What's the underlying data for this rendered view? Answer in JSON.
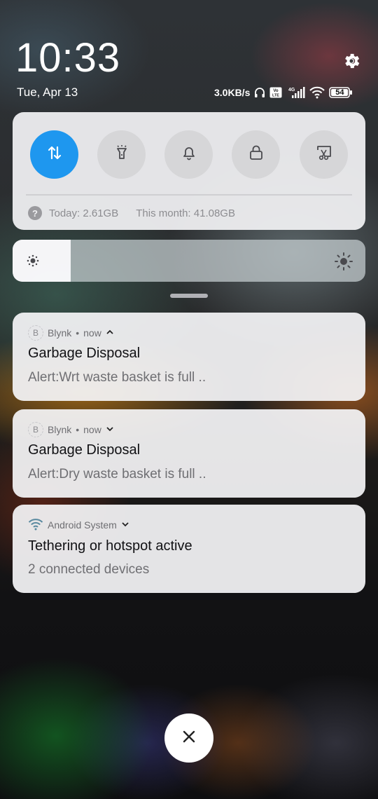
{
  "status": {
    "time": "10:33",
    "date": "Tue, Apr 13",
    "network_speed": "3.0KB/s",
    "battery_level": "54",
    "icons": [
      "headphones-icon",
      "volte-icon",
      "4g-signal-icon",
      "wifi-icon",
      "battery-icon"
    ]
  },
  "header": {
    "settings_icon": "gear-icon"
  },
  "quick_settings": {
    "toggles": [
      {
        "name": "mobile-data",
        "icon": "data-arrows-icon",
        "active": true
      },
      {
        "name": "flashlight",
        "icon": "flashlight-icon",
        "active": false
      },
      {
        "name": "sound",
        "icon": "bell-icon",
        "active": false
      },
      {
        "name": "lock-screen",
        "icon": "lock-icon",
        "active": false
      },
      {
        "name": "screenshot",
        "icon": "screenshot-scissors-icon",
        "active": false
      }
    ],
    "data_usage": {
      "today": "Today: 2.61GB",
      "month": "This month: 41.08GB"
    }
  },
  "brightness": {
    "level": 0.165
  },
  "notifications": [
    {
      "app": "Blynk",
      "time": "now",
      "app_icon_letter": "B",
      "title": "Garbage Disposal",
      "body": "Alert:Wrt waste basket is full ..",
      "expanded": true
    },
    {
      "app": "Blynk",
      "time": "now",
      "app_icon_letter": "B",
      "title": "Garbage Disposal",
      "body": "Alert:Dry waste basket is full ..",
      "expanded": false
    },
    {
      "app": "Android System",
      "title": "Tethering or hotspot active",
      "body": "2 connected devices",
      "expanded": false
    }
  ],
  "dots": "•",
  "colors": {
    "accent": "#1e97ef",
    "card_bg": "#f0f0f2"
  }
}
